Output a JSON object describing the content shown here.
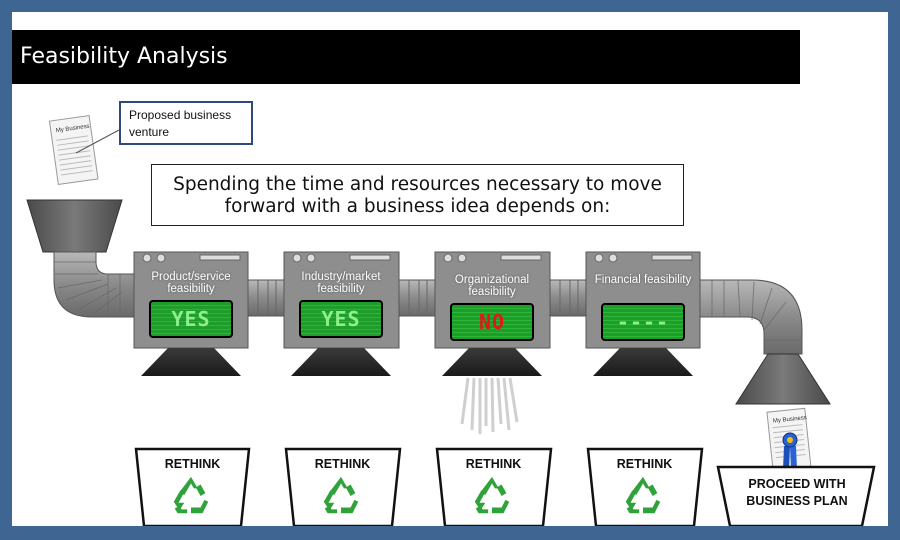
{
  "slide": {
    "title": "Feasibility Analysis",
    "callout": "Proposed business venture",
    "question": "Spending the time and resources necessary to move forward with a business idea depends on:"
  },
  "document_caption": "My Business",
  "stages": [
    {
      "label": "Product/service feasibility",
      "result": "YES",
      "status": "pass"
    },
    {
      "label": "Industry/market feasibility",
      "result": "YES",
      "status": "pass"
    },
    {
      "label": "Organizational feasibility",
      "result": "NO",
      "status": "fail"
    },
    {
      "label": "Financial feasibility",
      "result": "----",
      "status": "pending"
    }
  ],
  "bins": [
    {
      "label": "RETHINK",
      "icon": "recycle-icon"
    },
    {
      "label": "RETHINK",
      "icon": "recycle-icon"
    },
    {
      "label": "RETHINK",
      "icon": "recycle-icon"
    },
    {
      "label": "RETHINK",
      "icon": "recycle-icon"
    }
  ],
  "final_bin": {
    "label": "PROCEED WITH BUSINESS PLAN",
    "icon": "award-ribbon-icon"
  },
  "colors": {
    "frame": "#3f6592",
    "title_bar": "#000000",
    "machine_gray": "#8e8e8e",
    "screen_green": "#1f9d2a",
    "yes_text": "#8df08d",
    "no_text": "#e01818",
    "recycle_green": "#2fa33a",
    "ribbon_blue": "#1d4fb8"
  }
}
